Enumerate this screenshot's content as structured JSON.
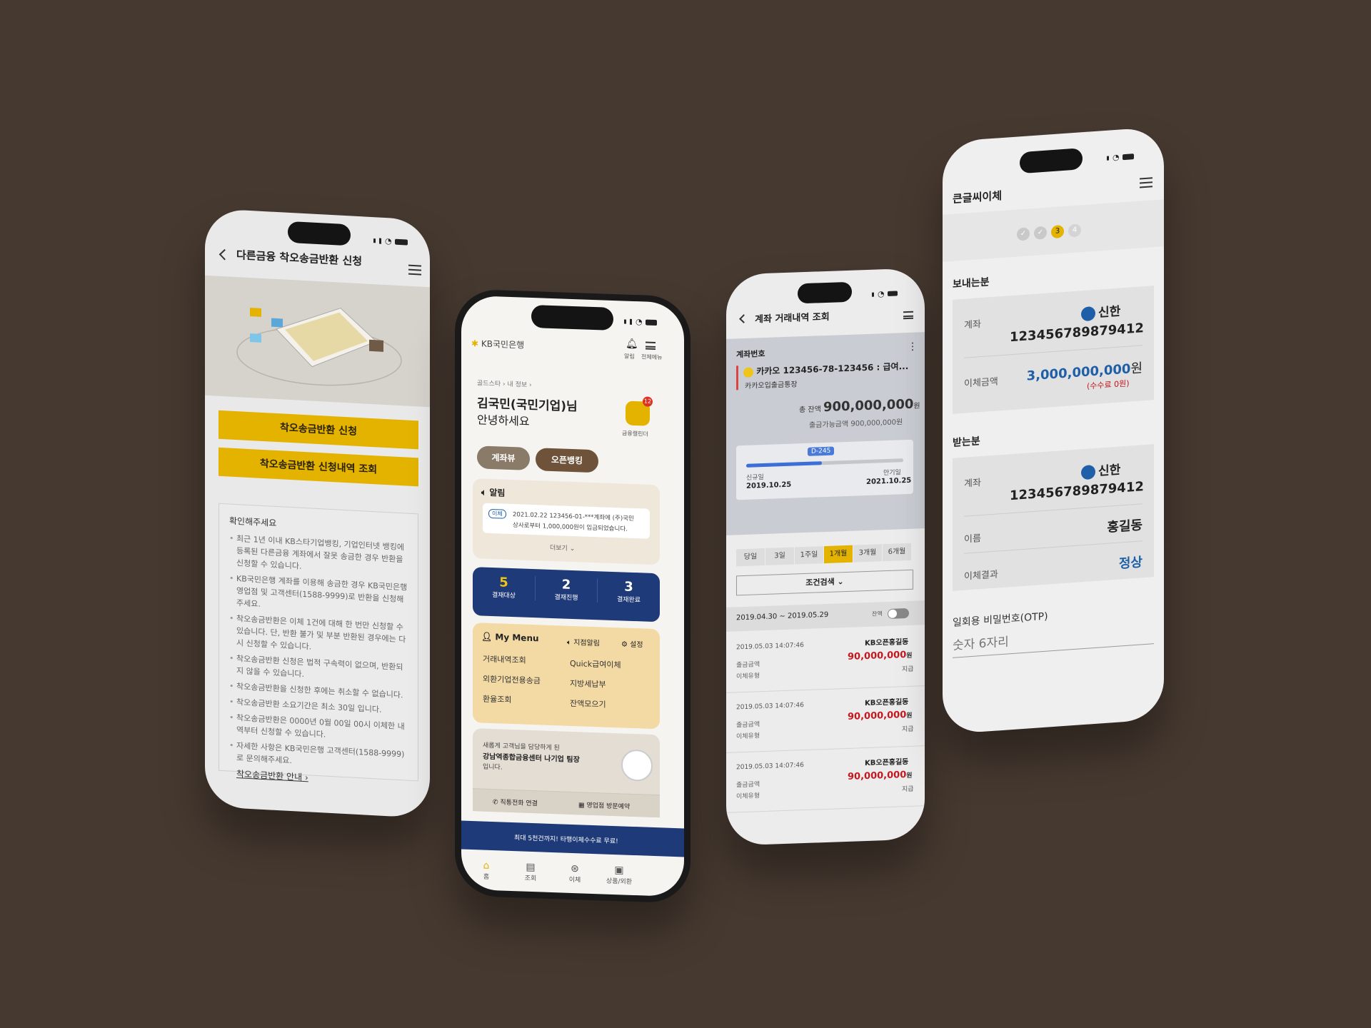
{
  "phone1": {
    "title": "다른금융 착오송금반환 신청",
    "btn_apply": "착오송금반환 신청",
    "btn_history": "착오송금반환 신청내역 조회",
    "notice_title": "확인해주세요",
    "notices": [
      "최근 1년 이내 KB스타기업뱅킹, 기업인터넷 뱅킹에 등록된 다른금융 계좌에서 잘못 송금한 경우 반환을 신청할 수 있습니다.",
      "KB국민은행 계좌를 이용해 송금한 경우 KB국민은행 영업점 및 고객센터(1588-9999)로 반환을 신청해주세요.",
      "착오송금반환은 이체 1건에 대해 한 번만 신청할 수 있습니다. 단, 반환 불가 및 부분 반환된 경우에는 다시 신청할 수 있습니다.",
      "착오송금반환 신청은 법적 구속력이 없으며, 반환되지 않을 수 있습니다.",
      "착오송금반환을 신청한 후에는 취소할 수 없습니다.",
      "착오송금반환 소요기간은 최소 30일 입니다.",
      "착오송금반환은 0000년 0월 00일 00시 이체한 내역부터 신청할 수 있습니다.",
      "자세한 사항은 KB국민은행 고객센터(1588-9999)로 문의해주세요."
    ],
    "guide_link": "착오송금반환 안내"
  },
  "phone2": {
    "logo": "KB국민은행",
    "bell_label": "알림",
    "menu_label": "전체메뉴",
    "breadcrumb": "골드스타 › 내 정보 ›",
    "user_name": "김국민(국민기업)님",
    "greeting": "안녕하세요",
    "calendar_label": "금융캘린더",
    "calendar_badge": "12",
    "tab_account": "계좌뷰",
    "tab_open": "오픈뱅킹",
    "alert_title": "알림",
    "alert_tag": "이체",
    "alert_text1": "2021.02.22 123456-01-***계좌에 (주)국민",
    "alert_text2": "상사로부터 1,000,000원이 입금되었습니다.",
    "more": "더보기",
    "stats": [
      {
        "num": "5",
        "label": "결재대상"
      },
      {
        "num": "2",
        "label": "결재진행"
      },
      {
        "num": "3",
        "label": "결재완료"
      }
    ],
    "mymenu_title": "My Menu",
    "branch_alert": "지점알림",
    "settings": "설정",
    "menu_left": [
      "거래내역조회",
      "외환기업전용송금",
      "환율조회"
    ],
    "menu_right": [
      "Quick급여이체",
      "지방세납부",
      "잔액모으기"
    ],
    "manager_line1": "새롭게 고객님을 담당하게 된",
    "manager_line2": "강남역종합금융센터 나기업 팀장",
    "manager_line3": "입니다.",
    "call_btn": "직통전화 연결",
    "visit_btn": "영업점 방문예약",
    "banner": "최대 5천건까지! 타행이체수수료 무료!",
    "nav": [
      "홈",
      "조회",
      "이체",
      "상품/외환"
    ]
  },
  "phone3": {
    "title": "계좌 거래내역 조회",
    "account_label": "계좌번호",
    "account_name": "카카오 123456-78-123456 : 급여...",
    "account_type": "카카오입출금통장",
    "balance_label": "총 잔액",
    "balance": "900,000,000",
    "won": "원",
    "available": "출금가능금액 900,000,000원",
    "dday": "D-245",
    "dday_progress": 0.48,
    "start_label": "신규일",
    "start_date": "2019.10.25",
    "end_label": "만기일",
    "end_date": "2021.10.25",
    "periods": [
      "당일",
      "3일",
      "1주일",
      "1개월",
      "3개월",
      "6개월"
    ],
    "search_btn": "조건검색",
    "range": "2019.04.30 ~ 2019.05.29",
    "toggle_label": "잔액",
    "txns": [
      {
        "date": "2019.05.03  14:07:46",
        "name": "KB오픈홍길동",
        "l1": "출금금액",
        "l2": "이체유형",
        "amount": "90,000,000",
        "type": "지급"
      },
      {
        "date": "2019.05.03  14:07:46",
        "name": "KB오픈홍길동",
        "l1": "출금금액",
        "l2": "이체유형",
        "amount": "90,000,000",
        "type": "지급"
      },
      {
        "date": "2019.05.03  14:07:46",
        "name": "KB오픈홍길동",
        "l1": "출금금액",
        "l2": "이체유형",
        "amount": "90,000,000",
        "type": "지급"
      }
    ]
  },
  "phone4": {
    "title": "큰글씨이체",
    "step_current": "3",
    "step_next": "4",
    "sender_title": "보내는분",
    "account_label": "계좌",
    "bank": "신한",
    "sender_account": "123456789879412",
    "amount_label": "이체금액",
    "amount": "3,000,000,000",
    "won": "원",
    "fee": "(수수료 0원)",
    "receiver_title": "받는분",
    "receiver_account": "123456789879412",
    "name_label": "이름",
    "name": "홍길동",
    "result_label": "이체결과",
    "result": "정상",
    "otp_label": "일회용 비밀번호(OTP)",
    "otp_placeholder": "숫자 6자리"
  },
  "colors": {
    "kb_yellow": "#e3b300",
    "navy": "#1f3a78",
    "brown": "#8a6a4a",
    "red": "#c4161c",
    "blue": "#1f5fa8"
  }
}
